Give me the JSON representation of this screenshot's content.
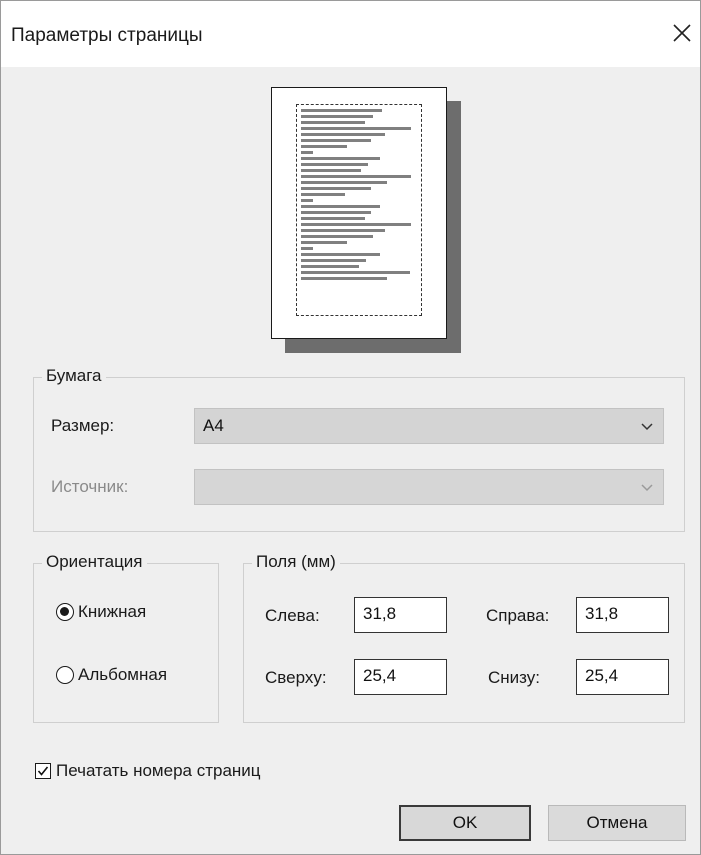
{
  "dialog": {
    "title": "Параметры страницы",
    "close_icon": "close-icon"
  },
  "paper": {
    "group_label": "Бумага",
    "size_label": "Размер:",
    "size_value": "A4",
    "source_label": "Источник:",
    "source_value": ""
  },
  "orientation": {
    "group_label": "Ориентация",
    "options": [
      {
        "label": "Книжная",
        "selected": true
      },
      {
        "label": "Альбомная",
        "selected": false
      }
    ]
  },
  "margins": {
    "group_label": "Поля (мм)",
    "left_label": "Слева:",
    "left_value": "31,8",
    "right_label": "Справа:",
    "right_value": "31,8",
    "top_label": "Сверху:",
    "top_value": "25,4",
    "bottom_label": "Снизу:",
    "bottom_value": "25,4"
  },
  "print_page_numbers": {
    "label": "Печатать номера страниц",
    "checked": true
  },
  "buttons": {
    "ok": "OK",
    "cancel": "Отмена"
  }
}
